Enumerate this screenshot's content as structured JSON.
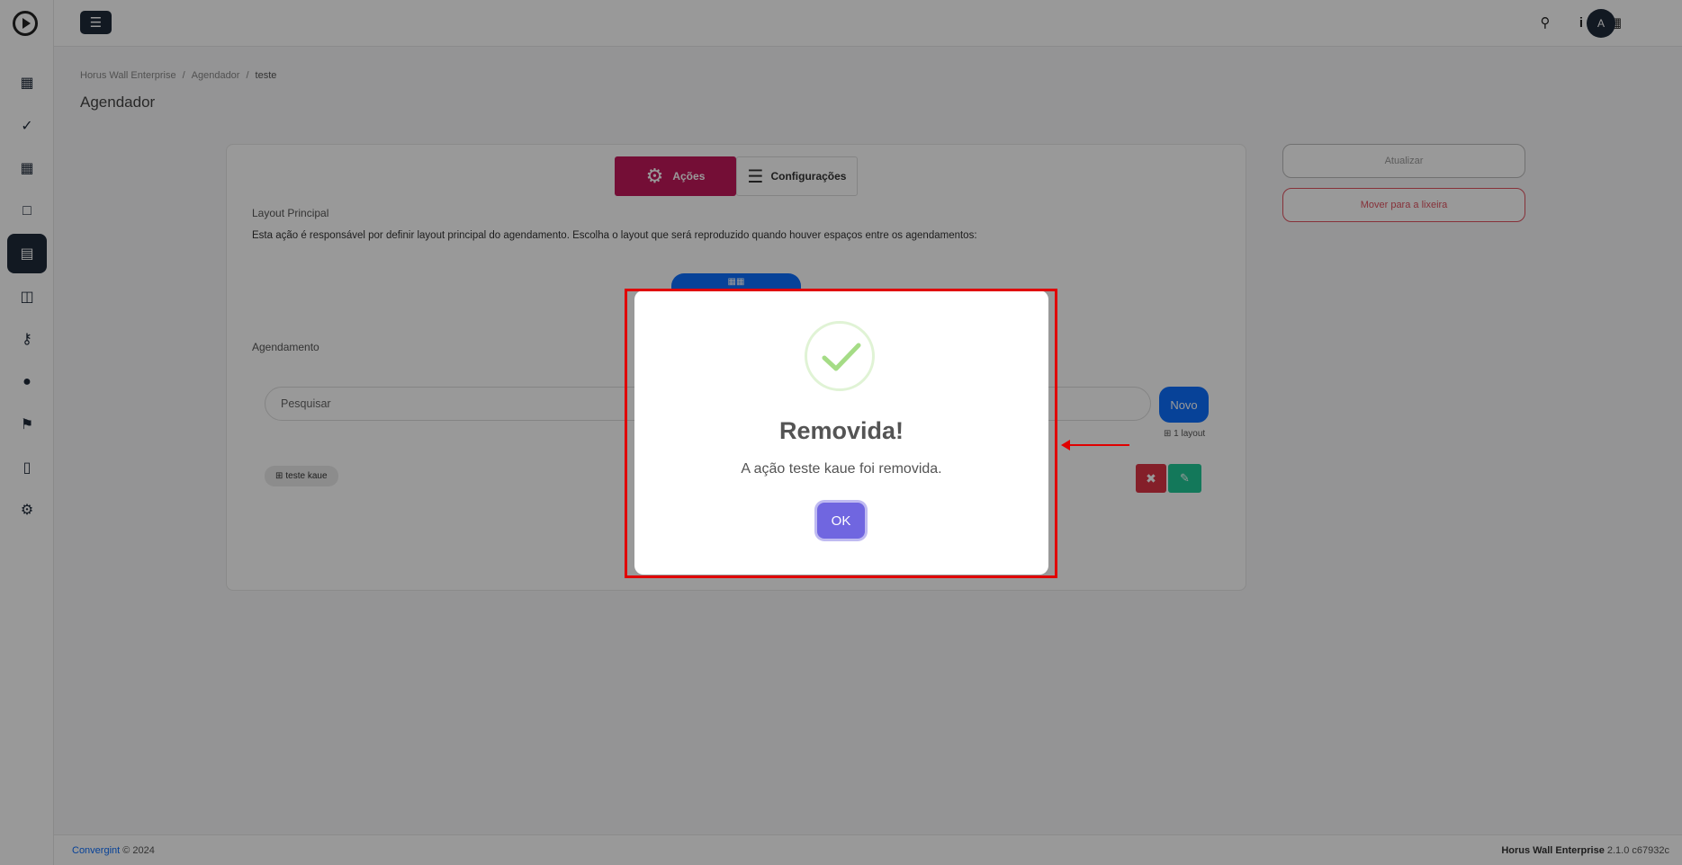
{
  "sidebar": {
    "items": [
      {
        "icon": "dashboard-icon"
      },
      {
        "icon": "satellite-dish-icon"
      },
      {
        "icon": "grid-icon"
      },
      {
        "icon": "layout-icon"
      },
      {
        "icon": "calendar-icon",
        "active": true
      },
      {
        "icon": "images-icon"
      },
      {
        "icon": "key-icon"
      },
      {
        "icon": "users-icon"
      },
      {
        "icon": "flag-icon"
      },
      {
        "icon": "trash-icon"
      },
      {
        "icon": "gear-icon"
      }
    ]
  },
  "topbar": {
    "icons": [
      "search-icon",
      "info-icon",
      "apps-grid-icon"
    ],
    "avatar_initial": "A"
  },
  "breadcrumb": {
    "items": [
      "Horus Wall Enterprise",
      "Agendador",
      "teste"
    ]
  },
  "page": {
    "title": "Agendador"
  },
  "tabs": {
    "actions_label": "Ações",
    "config_label": "Configurações"
  },
  "layout_section": {
    "title": "Layout Principal",
    "description": "Esta ação é responsável por definir layout principal do agendamento. Escolha o layout que será reproduzido quando houver espaços entre os agendamentos:"
  },
  "schedule_section": {
    "title": "Agendamento",
    "search_placeholder": "Pesquisar",
    "new_button": "Novo",
    "layout_count": "1 layout",
    "tag_label": "teste kaue"
  },
  "side_actions": {
    "refresh_label": "Atualizar",
    "trash_label": "Mover para a lixeira"
  },
  "footer": {
    "brand": "Convergint",
    "copyright": " © 2024",
    "product": "Horus Wall Enterprise",
    "version": " 2.1.0 c67932c"
  },
  "modal": {
    "title": "Removida!",
    "text": "A ação teste kaue foi removida.",
    "ok_label": "OK"
  },
  "colors": {
    "primary": "#0d6efd",
    "actions_tab": "#c2185b",
    "danger": "#dc3545",
    "success_edit": "#20c997",
    "ok_button": "#7066e0",
    "annotation": "#e00000"
  }
}
